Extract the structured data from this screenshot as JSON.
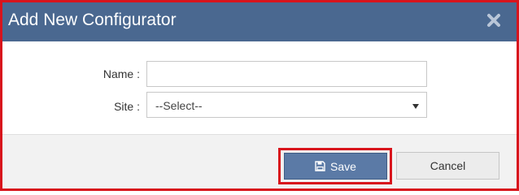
{
  "dialog": {
    "title": "Add New Configurator",
    "close_icon": "close-icon"
  },
  "form": {
    "name_label": "Name :",
    "name_value": "",
    "site_label": "Site :",
    "site_selected": "--Select--"
  },
  "footer": {
    "save_label": "Save",
    "save_icon": "floppy-disk-icon",
    "cancel_label": "Cancel"
  },
  "colors": {
    "header_bg": "#4a6890",
    "primary_button": "#5b7aa6",
    "highlight_border": "#d8141c"
  }
}
